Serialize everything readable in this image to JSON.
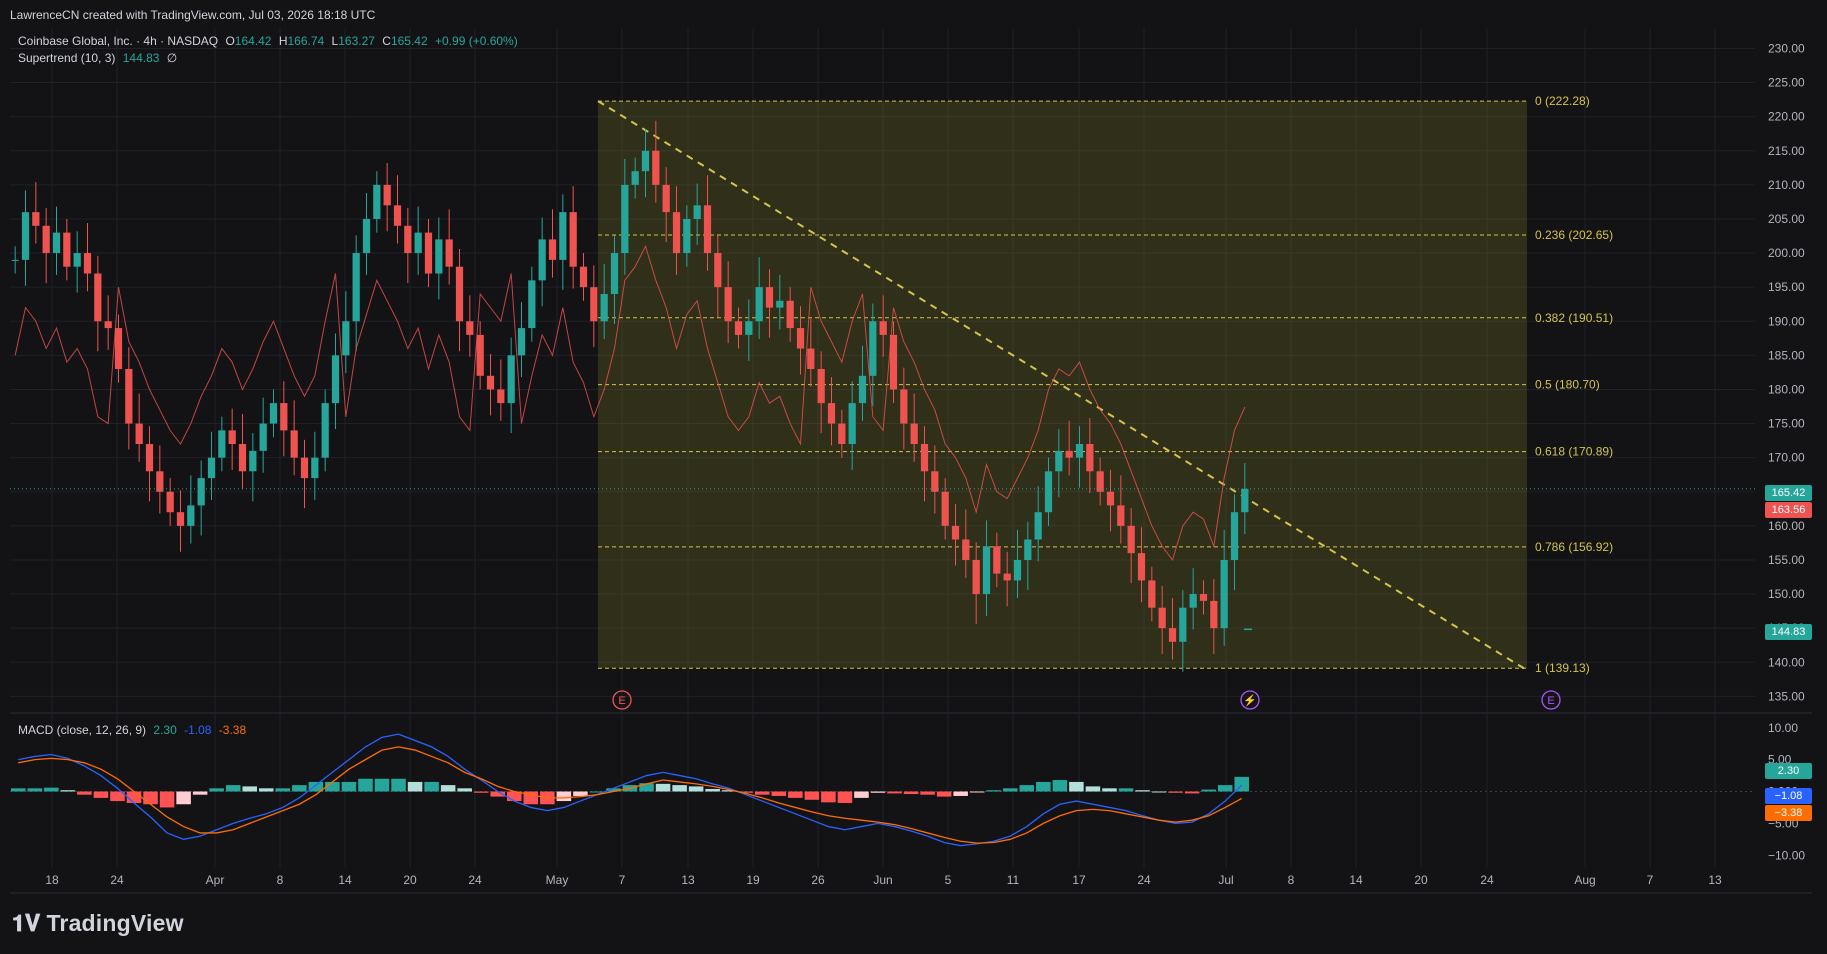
{
  "credit": "LawrenceCN created with TradingView.com, Jul 03, 2026 18:18 UTC",
  "legend": {
    "symbol": "Coinbase Global, Inc. · 4h · NASDAQ",
    "open_label": "O",
    "open": "164.42",
    "high_label": "H",
    "high": "166.74",
    "low_label": "L",
    "low": "163.27",
    "close_label": "C",
    "close": "165.42",
    "change": "+0.99 (+0.60%)",
    "supertrend_label": "Supertrend (10, 3)",
    "supertrend_value": "144.83",
    "supertrend_extra": "∅"
  },
  "macd_legend": {
    "label": "MACD (close, 12, 26, 9)",
    "macd": "2.30",
    "signal": "-1.08",
    "hist": "-3.38"
  },
  "price_tags": {
    "last": "165.42",
    "prev": "163.56",
    "supertrend": "144.83",
    "macd": "2.30",
    "signal": "−1.08",
    "hist": "−3.38"
  },
  "logo": "TradingView",
  "colors": {
    "up": "#26a69a",
    "down": "#ef5350",
    "fib": "#d4c44a",
    "macd_line": "#2962ff",
    "signal_line": "#ff6d00"
  },
  "chart_data": [
    {
      "type": "candlestick",
      "title": "Coinbase Global, Inc. · 4h · NASDAQ",
      "ylim": [
        133,
        233
      ],
      "y_ticks": [
        "135.00",
        "140.00",
        "145.00",
        "150.00",
        "155.00",
        "160.00",
        "165.00",
        "170.00",
        "175.00",
        "180.00",
        "185.00",
        "190.00",
        "195.00",
        "200.00",
        "205.00",
        "210.00",
        "215.00",
        "220.00",
        "225.00",
        "230.00"
      ],
      "x_ticks": [
        "18",
        "24",
        "Apr",
        "8",
        "14",
        "20",
        "24",
        "May",
        "7",
        "13",
        "19",
        "26",
        "Jun",
        "5",
        "11",
        "17",
        "24",
        "Jul",
        "8",
        "14",
        "20",
        "24",
        "Aug",
        "7",
        "13"
      ],
      "close_series": [
        199,
        206,
        204,
        200,
        203,
        198,
        200,
        197,
        190,
        189,
        183,
        175,
        172,
        168,
        165,
        162,
        160,
        163,
        167,
        170,
        174,
        172,
        168,
        171,
        175,
        178,
        174,
        170,
        167,
        170,
        178,
        185,
        190,
        200,
        205,
        210,
        207,
        204,
        200,
        203,
        197,
        202,
        198,
        190,
        188,
        182,
        180,
        178,
        185,
        189,
        196,
        202,
        199,
        206,
        198,
        195,
        190,
        194,
        200,
        210,
        212,
        215,
        210,
        206,
        200,
        205,
        207,
        200,
        195,
        190,
        188,
        190,
        195,
        192,
        193,
        189,
        186,
        183,
        178,
        175,
        172,
        178,
        182,
        190,
        188,
        180,
        175,
        172,
        168,
        165,
        160,
        158,
        155,
        150,
        157,
        153,
        152,
        155,
        158,
        162,
        168,
        171,
        170,
        172,
        168,
        165,
        163,
        160,
        156,
        152,
        148,
        145,
        143,
        148,
        150,
        149,
        145,
        155,
        162,
        165.42
      ],
      "fibonacci": [
        {
          "level": "0",
          "value": 222.28,
          "label": "0 (222.28)"
        },
        {
          "level": "0.236",
          "value": 202.65,
          "label": "0.236 (202.65)"
        },
        {
          "level": "0.382",
          "value": 190.51,
          "label": "0.382 (190.51)"
        },
        {
          "level": "0.5",
          "value": 180.7,
          "label": "0.5 (180.70)"
        },
        {
          "level": "0.618",
          "value": 170.89,
          "label": "0.618 (170.89)"
        },
        {
          "level": "0.786",
          "value": 156.92,
          "label": "0.786 (156.92)"
        },
        {
          "level": "1",
          "value": 139.13,
          "label": "1 (139.13)"
        }
      ],
      "supertrend": {
        "last": 144.83
      },
      "last_price": 165.42
    },
    {
      "type": "bar",
      "title": "MACD (close, 12, 26, 9)",
      "ylim": [
        -12,
        12
      ],
      "y_ticks": [
        "10.00",
        "5.00",
        "0.000",
        "−5.00",
        "−10.00"
      ],
      "macd": [
        5,
        5.5,
        5.8,
        5.2,
        4,
        2.5,
        0.5,
        -1.8,
        -4,
        -6.5,
        -7.5,
        -7,
        -6,
        -5,
        -4.2,
        -3.5,
        -2.5,
        -1,
        1,
        3,
        5,
        7,
        8.5,
        9,
        8,
        7,
        5.5,
        3.5,
        1.8,
        0,
        -1.5,
        -2.5,
        -3,
        -2.5,
        -1.5,
        -0.5,
        0.5,
        1.5,
        2.5,
        3,
        2.5,
        2,
        1.2,
        0.5,
        -0.5,
        -1.5,
        -2.5,
        -3.5,
        -4.5,
        -5.5,
        -6,
        -5.5,
        -5,
        -5.5,
        -6.2,
        -7,
        -8,
        -8.5,
        -8.2,
        -7.8,
        -7,
        -5.5,
        -3.5,
        -2,
        -1.5,
        -2,
        -2.5,
        -3,
        -3.8,
        -4.5,
        -5,
        -4.8,
        -3.5,
        -1.5,
        1
      ],
      "signal": [
        4.5,
        5,
        5.2,
        5,
        4.5,
        3.5,
        2,
        0,
        -2,
        -4,
        -5.5,
        -6.5,
        -6.5,
        -6,
        -5,
        -4,
        -3,
        -2,
        -0.5,
        1.5,
        3.5,
        5,
        6.5,
        7,
        6.5,
        5.5,
        4.5,
        3,
        2,
        0.8,
        0,
        -0.5,
        -1,
        -1,
        -0.8,
        -0.5,
        0,
        0.5,
        1.2,
        1.8,
        1.5,
        1.2,
        0.8,
        0.3,
        -0.3,
        -1,
        -1.8,
        -2.5,
        -3.2,
        -3.8,
        -4.2,
        -4.5,
        -4.8,
        -5.2,
        -5.8,
        -6.5,
        -7.2,
        -7.8,
        -8.1,
        -8,
        -7.5,
        -6.5,
        -5,
        -3.8,
        -3,
        -2.8,
        -3,
        -3.5,
        -4,
        -4.5,
        -4.8,
        -4.5,
        -3.8,
        -2.5,
        -1.08
      ],
      "histogram": [
        0.5,
        0.5,
        0.6,
        0.2,
        -0.5,
        -1,
        -1.5,
        -1.8,
        -2,
        -2.5,
        -2,
        -0.5,
        0.5,
        1,
        0.8,
        0.5,
        0.5,
        1,
        1.5,
        1.5,
        1.5,
        2,
        2,
        2,
        1.5,
        1.5,
        1,
        0.5,
        -0.2,
        -0.8,
        -1.5,
        -2,
        -2,
        -1.5,
        -0.7,
        0,
        0.5,
        1,
        1.3,
        1.2,
        1,
        0.8,
        0.4,
        0.2,
        -0.2,
        -0.5,
        -0.7,
        -1,
        -1.3,
        -1.7,
        -1.8,
        -1,
        -0.2,
        -0.3,
        -0.4,
        -0.5,
        -0.8,
        -0.7,
        -0.1,
        0.2,
        0.5,
        1,
        1.5,
        1.8,
        1.5,
        0.8,
        0.5,
        0.5,
        0.2,
        0,
        -0.2,
        -0.3,
        0.3,
        1,
        2.3
      ]
    }
  ]
}
